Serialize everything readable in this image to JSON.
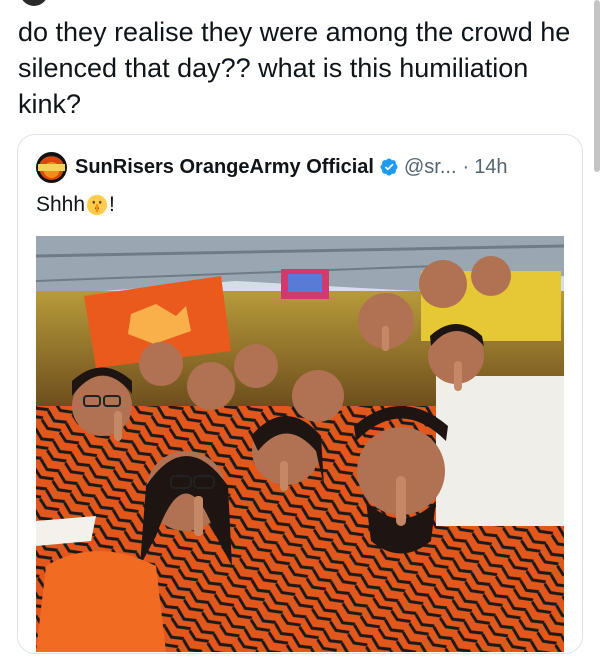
{
  "post": {
    "text": "do they realise they were among the crowd he silenced that day?? what is this humiliation kink?"
  },
  "quoted": {
    "display_name": "SunRisers OrangeArmy Official",
    "handle": "@sr...",
    "separator": "·",
    "time": "14h",
    "body_text": "Shhh",
    "body_suffix": "!",
    "emoji": "shushing-face-emoji",
    "verified_icon": "verified-badge-icon"
  },
  "colors": {
    "text": "#0f1419",
    "secondary_text": "#536471",
    "verified_blue": "#1d9bf0",
    "card_border": "#dde3e8",
    "team_orange": "#f26522"
  }
}
